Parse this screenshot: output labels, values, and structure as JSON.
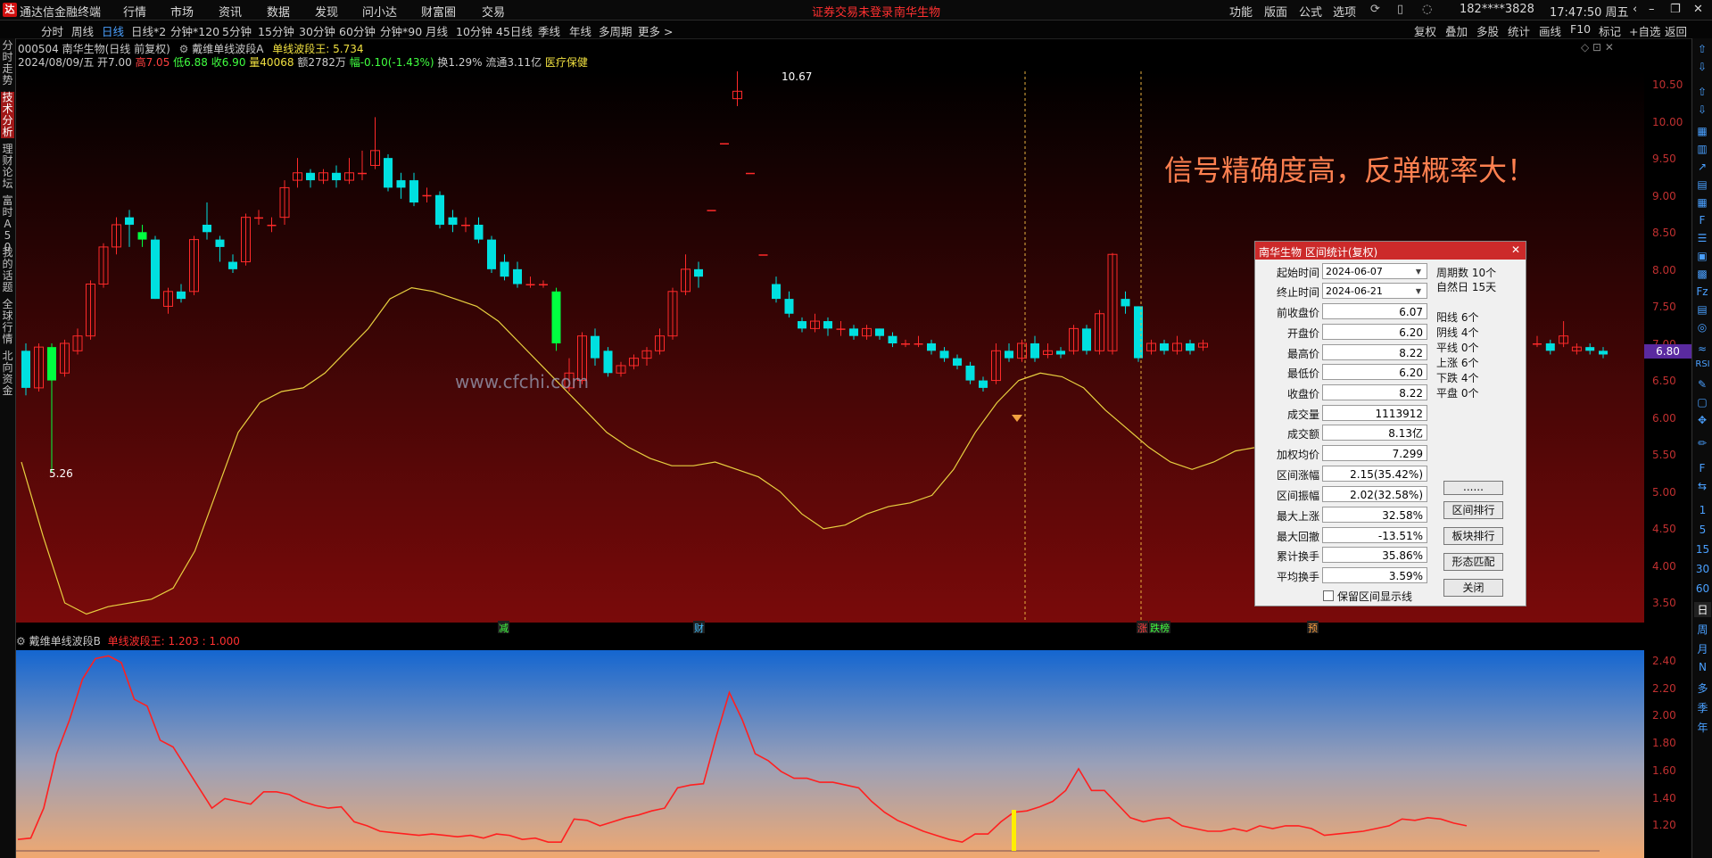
{
  "titlebar": {
    "app_name": "通达信金融终端",
    "menu": [
      "行情",
      "市场",
      "资讯",
      "数据",
      "发现",
      "问小达",
      "财富圈",
      "交易"
    ],
    "notice": "证券交易未登录",
    "stock": "南华生物",
    "right_menu": [
      "功能",
      "版面",
      "公式",
      "选项"
    ],
    "account": "182****3828",
    "clock": "17:47:50 周五"
  },
  "toolbar": {
    "periods": [
      "分时",
      "周线",
      "日线",
      "日线*2",
      "分钟*120",
      "5分钟",
      "15分钟",
      "30分钟",
      "60分钟",
      "分钟*90",
      "月线",
      "10分钟",
      "45日线",
      "季线",
      "年线",
      "多周期",
      "更多 >"
    ],
    "active_period": "日线",
    "right_items": [
      "复权",
      "叠加",
      "多股",
      "统计",
      "画线",
      "F10",
      "标记",
      "+自选",
      "返回"
    ]
  },
  "left_tabs": [
    "分时走势",
    "技术分析",
    "理财论坛",
    "富时A50",
    "我的话题",
    "全球行情",
    "北向资金"
  ],
  "info": {
    "line1_code": "000504 南华生物(日线 前复权)",
    "line1_indicator": "戴维单线波段A",
    "line1_value": "单线波段王: 5.734",
    "date": "2024/08/09/五",
    "open": "开7.00",
    "high": "高7.05",
    "low": "低6.88",
    "close": "收6.90",
    "volume": "量40068",
    "amount": "额2782万",
    "change": "幅-0.10(-1.43%)",
    "turnover": "换1.29%",
    "float": "流通3.11亿",
    "sector": "医疗保健"
  },
  "main_chart": {
    "price_axis": [
      "10.50",
      "10.00",
      "9.50",
      "9.00",
      "8.50",
      "8.00",
      "7.50",
      "7.00",
      "6.50",
      "6.00",
      "5.50",
      "5.00",
      "4.50",
      "4.00",
      "3.50"
    ],
    "current_price": "6.80",
    "max_marker": "10.67",
    "min_marker": "5.26",
    "event_marks": [
      "减",
      "财",
      "涨",
      "跌榜",
      "预"
    ],
    "watermark": "www.cfchi.com",
    "promo": "信号精确度高，反弹概率大！"
  },
  "sub_chart": {
    "indicator": "戴维单线波段B",
    "value_label": "单线波段王: 1.203 : 1.000",
    "axis": [
      "2.40",
      "2.20",
      "2.00",
      "1.80",
      "1.60",
      "1.40",
      "1.20"
    ]
  },
  "dialog": {
    "title": "南华生物 区间统计(复权)",
    "start_label": "起始时间",
    "start": "2024-06-07",
    "end_label": "终止时间",
    "end": "2024-06-21",
    "rows": [
      {
        "label": "前收盘价",
        "value": "6.07"
      },
      {
        "label": "开盘价",
        "value": "6.20"
      },
      {
        "label": "最高价",
        "value": "8.22"
      },
      {
        "label": "最低价",
        "value": "6.20"
      },
      {
        "label": "收盘价",
        "value": "8.22"
      },
      {
        "label": "成交量",
        "value": "1113912"
      },
      {
        "label": "成交额",
        "value": "8.13亿"
      },
      {
        "label": "加权均价",
        "value": "7.299"
      },
      {
        "label": "区间涨幅",
        "value": "2.15(35.42%)"
      },
      {
        "label": "区间振幅",
        "value": "2.02(32.58%)"
      },
      {
        "label": "最大上涨",
        "value": "32.58%"
      },
      {
        "label": "最大回撤",
        "value": "-13.51%"
      },
      {
        "label": "累计换手",
        "value": "35.86%"
      },
      {
        "label": "平均换手",
        "value": "3.59%"
      }
    ],
    "stats_top": [
      "周期数 10个",
      "自然日 15天"
    ],
    "stats": [
      "阳线 6个",
      "阴线 4个",
      "平线 0个",
      "上涨 6个",
      "下跌 4个",
      "平盘 0个"
    ],
    "buttons": [
      "......",
      "区间排行",
      "板块排行",
      "形态匹配",
      "关闭"
    ],
    "checkbox_label": "保留区间显示线"
  },
  "right_strip": [
    "RSI",
    "1",
    "5",
    "15",
    "30",
    "60",
    "日",
    "周",
    "月",
    "N",
    "多",
    "季",
    "年"
  ],
  "colors": {
    "up": "#ff2a2a",
    "down": "#00e0e0",
    "down_big": "#00ff40",
    "ma": "#e8d040",
    "sub_line": "#ff2020",
    "bg_top": "#000000",
    "bg_bottom": "#7a0a0a"
  }
}
